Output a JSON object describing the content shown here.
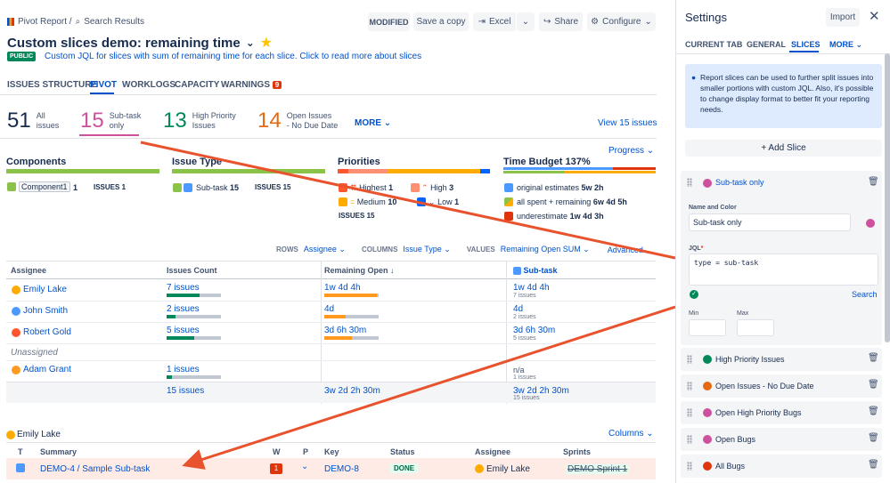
{
  "breadcrumb": {
    "root": "Pivot Report /",
    "search": "Search Results"
  },
  "header": {
    "badge": "MODIFIED",
    "save": "Save a copy",
    "excel": "Excel",
    "share": "Share",
    "configure": "Configure"
  },
  "title": "Custom slices demo: remaining time",
  "public_badge": "PUBLIC",
  "description": "Custom JQL for slices with sum of remaining time for each slice. Click to read more about slices",
  "tabs": [
    "ISSUES STRUCTURE",
    "PIVOT",
    "WORKLOGS",
    "CAPACITY",
    "WARNINGS"
  ],
  "warnings_count": "9",
  "stats": [
    {
      "num": "51",
      "label1": "All",
      "label2": "issues",
      "color": "#172b4d"
    },
    {
      "num": "15",
      "label1": "Sub-task",
      "label2": "only",
      "color": "#cd519d"
    },
    {
      "num": "13",
      "label1": "High Priority",
      "label2": "Issues",
      "color": "#00875a"
    },
    {
      "num": "14",
      "label1": "Open Issues",
      "label2": "- No Due Date",
      "color": "#e56910"
    }
  ],
  "more": "MORE",
  "view_issues": "View 15 issues",
  "progress": "Progress",
  "panels": {
    "components": {
      "title": "Components",
      "item": "Component1",
      "count": "1",
      "issues": "ISSUES 1"
    },
    "issue_type": {
      "title": "Issue Type",
      "item": "Sub-task",
      "count": "15",
      "issues": "ISSUES 15"
    },
    "priorities": {
      "title": "Priorities",
      "highest": "Highest",
      "highest_n": "1",
      "high": "High",
      "high_n": "3",
      "medium": "Medium",
      "medium_n": "10",
      "low": "Low",
      "low_n": "1",
      "issues": "ISSUES 15"
    },
    "time_budget": {
      "title": "Time Budget 137%",
      "orig": "original estimates",
      "orig_v": "5w 2h",
      "spent": "all spent + remaining",
      "spent_v": "6w 4d 5h",
      "under": "underestimate",
      "under_v": "1w 4d 3h"
    }
  },
  "controls": {
    "rows": "ROWS",
    "rows_v": "Assignee",
    "cols": "COLUMNS",
    "cols_v": "Issue Type",
    "values": "VALUES",
    "values_v": "Remaining Open SUM",
    "advanced": "Advanced"
  },
  "table": {
    "headers": [
      "Assignee",
      "Issues Count",
      "Remaining Open",
      "Sub-task"
    ],
    "rows": [
      {
        "name": "Emily Lake",
        "count": "7 issues",
        "remaining": "1w 4d 4h",
        "sub": "1w 4d 4h",
        "sub_small": "7 issues",
        "countFill": 0.61,
        "remFill": 0.97
      },
      {
        "name": "John Smith",
        "count": "2 issues",
        "remaining": "4d",
        "sub": "4d",
        "sub_small": "2 issues",
        "countFill": 0.17,
        "remFill": 0.4
      },
      {
        "name": "Robert Gold",
        "count": "5 issues",
        "remaining": "3d 6h 30m",
        "sub": "3d 6h 30m",
        "sub_small": "5 issues",
        "countFill": 0.5,
        "remFill": 0.5
      }
    ],
    "unassigned": "Unassigned",
    "adam": {
      "name": "Adam Grant",
      "count": "1 issues",
      "sub": "n/a",
      "sub_small": "1 issues",
      "countFill": 0.1
    },
    "total": {
      "count": "15 issues",
      "remaining": "3w 2d 2h 30m",
      "sub": "3w 2d 2h 30m",
      "sub_small": "15 issues"
    }
  },
  "detail": {
    "user": "Emily Lake",
    "columns": "Columns",
    "headers": [
      "T",
      "Summary",
      "W",
      "P",
      "Key",
      "Status",
      "Assignee",
      "Sprints"
    ],
    "row": {
      "summary1": "DEMO-4 /",
      "summary2": "Sample Sub-task",
      "w": "1",
      "key": "DEMO-8",
      "status": "DONE",
      "assignee": "Emily Lake",
      "sprint": "DEMO Sprint 1"
    }
  },
  "settings": {
    "title": "Settings",
    "import": "Import",
    "tabs": [
      "CURRENT TAB",
      "GENERAL",
      "SLICES",
      "MORE"
    ],
    "info": "Report slices can be used to further split issues into smaller portions with custom JQL. Also, it's possible to change display format to better fit your reporting needs.",
    "add": "+ Add Slice",
    "active": {
      "name": "Sub-task only",
      "name_color_label": "Name and Color",
      "name_value": "Sub-task only",
      "jql_label": "JQL",
      "jql": "type = sub-task",
      "search": "Search",
      "min": "Min",
      "max": "Max"
    },
    "slices": [
      {
        "name": "High Priority Issues",
        "color": "#00875a"
      },
      {
        "name": "Open Issues - No Due Date",
        "color": "#e56910"
      },
      {
        "name": "Open High Priority Bugs",
        "color": "#cd519d"
      },
      {
        "name": "Open Bugs",
        "color": "#cd519d"
      },
      {
        "name": "All Bugs",
        "color": "#de350b"
      }
    ]
  },
  "colors": {
    "accent": "#0052cc",
    "arrow": "#e8532d",
    "subtask": "#cd519d",
    "green": "#00875a",
    "orange": "#e56910"
  }
}
